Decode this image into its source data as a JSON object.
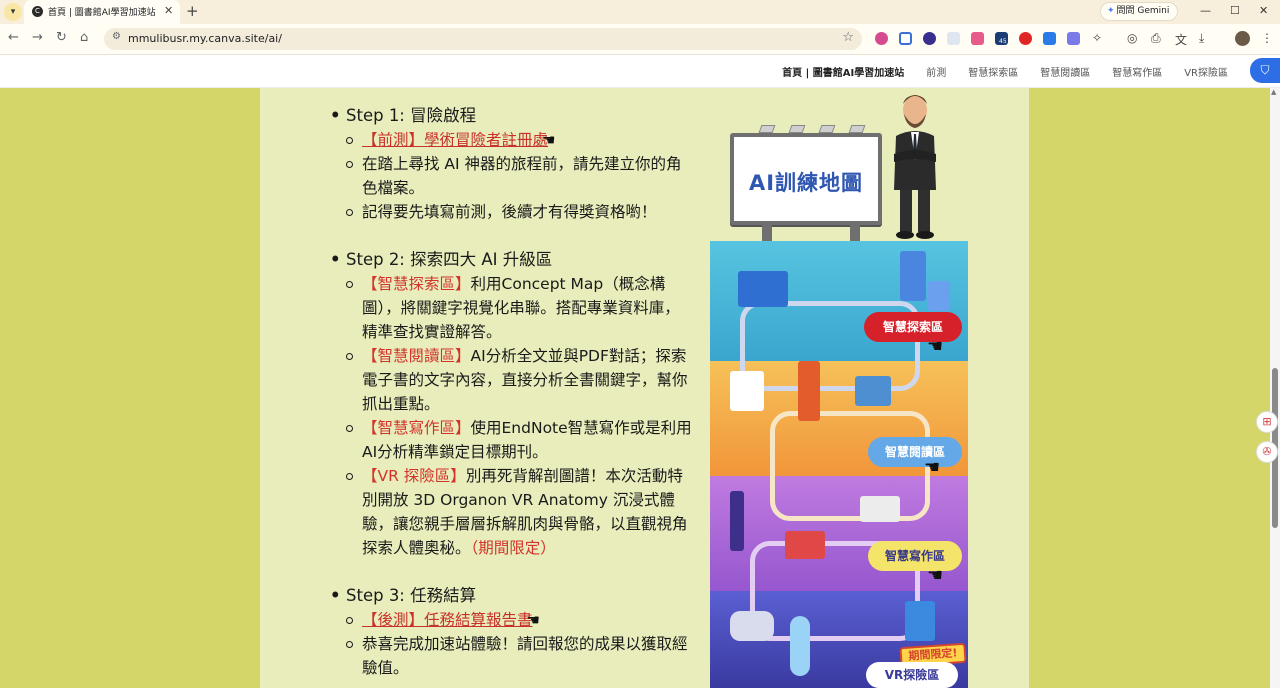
{
  "browser": {
    "tab": {
      "title": "首頁 | 圖書館AI學習加速站",
      "favicon": "C",
      "close": "✕"
    },
    "new_tab": "+",
    "gemini_label": "問問 Gemini",
    "window_controls": [
      "—",
      "☐",
      "✕"
    ],
    "url": "mmulibusr.my.canva.site/ai/",
    "icons": [
      "back-arrow-icon",
      "forward-arrow-icon",
      "reload-icon",
      "home-icon",
      "site-info-icon",
      "bookmark-star-icon",
      "extensions-puzzle-icon",
      "screenshot-icon",
      "print-icon",
      "translate-icon",
      "download-icon",
      "profile-avatar-icon",
      "kebab-menu-icon"
    ],
    "ext_badge": "45"
  },
  "site": {
    "nav": [
      {
        "label": "首頁 | 圖書館AI學習加速站",
        "active": true
      },
      {
        "label": "前測",
        "active": false
      },
      {
        "label": "智慧探索區",
        "active": false
      },
      {
        "label": "智慧閱讀區",
        "active": false
      },
      {
        "label": "智慧寫作區",
        "active": false
      },
      {
        "label": "VR探險區",
        "active": false
      }
    ]
  },
  "content": {
    "step1": {
      "title": "Step 1: 冒險啟程",
      "link": "【前測】學術冒險者註冊處",
      "items": [
        "在踏上尋找 AI 神器的旅程前，請先建立你的角色檔案。",
        "記得要先填寫前測，後續才有得獎資格喲！"
      ]
    },
    "step2": {
      "title": "Step 2: 探索四大 AI 升級區",
      "items": [
        {
          "tag": "【智慧探索區】",
          "text": "利用Concept Map（概念構圖），將關鍵字視覺化串聯。搭配專業資料庫，精準查找實證解答。"
        },
        {
          "tag": "【智慧閱讀區】",
          "text": "AI分析全文並與PDF對話；探索電子書的文字內容，直接分析全書關鍵字，幫你抓出重點。"
        },
        {
          "tag": "【智慧寫作區】",
          "text": "使用EndNote智慧寫作或是利用AI分析精準鎖定目標期刊。"
        },
        {
          "tag": "【VR 探險區】",
          "text": "別再死背解剖圖譜！本次活動特別開放 3D Organon VR Anatomy 沉浸式體驗，讓您親手層層拆解肌肉與骨骼，以直觀視角探索人體奧秘。",
          "suffix": "（期間限定）"
        }
      ]
    },
    "step3": {
      "title": "Step 3: 任務結算",
      "link": "【後測】任務結算報告書",
      "items": [
        "恭喜完成加速站體驗！請回報您的成果以獲取經驗值。"
      ]
    }
  },
  "infographic": {
    "billboard": "AI訓練地圖",
    "zones": [
      "智慧探索區",
      "智慧閱讀區",
      "智慧寫作區",
      "VR探險區"
    ],
    "limited_badge": "期間限定!",
    "colors": {
      "explore": "#3fb6d6",
      "read": "#f4a93a",
      "write": "#a86ad8",
      "vr": "#4a55c8",
      "red_label": "#d6212a",
      "blue_label": "#64a8e8",
      "yellow_label": "#f4e46a"
    }
  }
}
